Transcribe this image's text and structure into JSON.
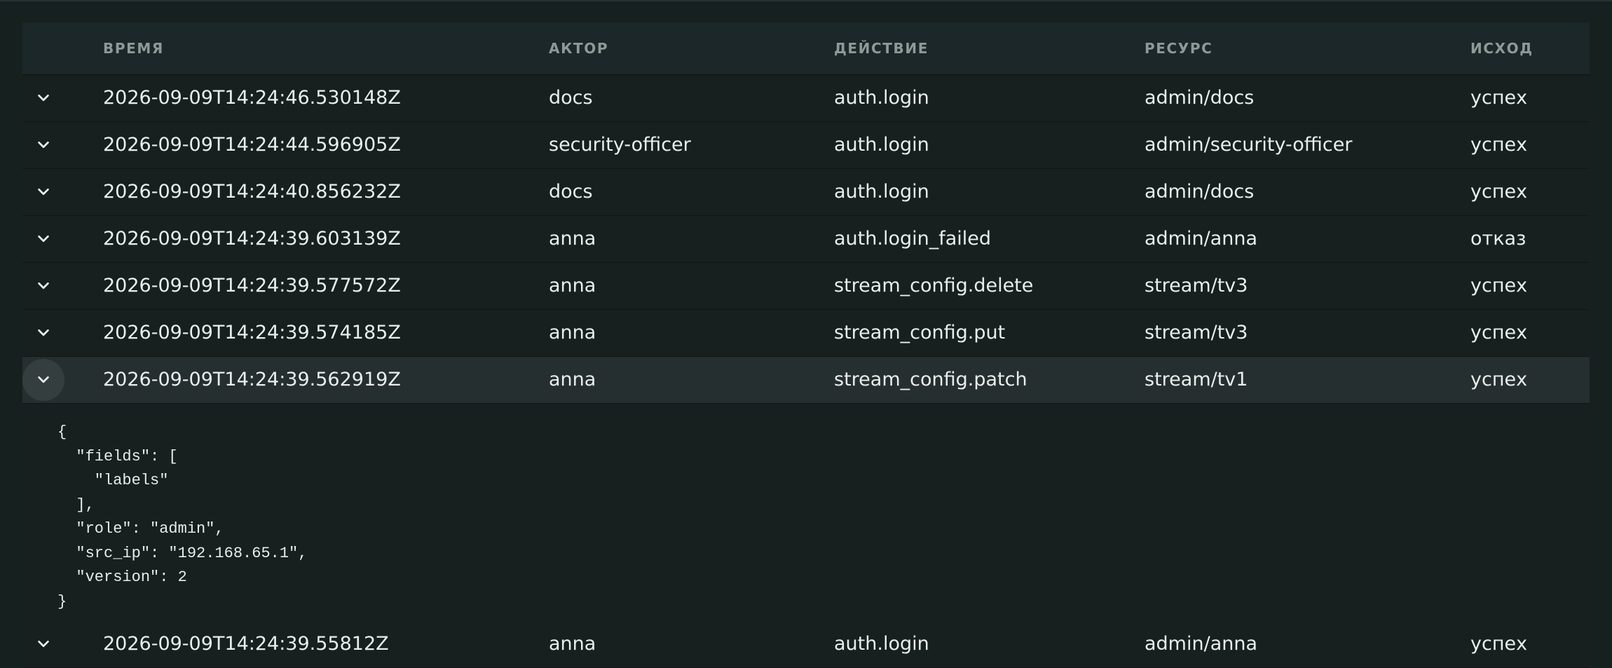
{
  "table": {
    "columns": {
      "time": "ВРЕМЯ",
      "actor": "АКТОР",
      "action": "ДЕЙСТВИЕ",
      "resource": "РЕСУРС",
      "outcome": "ИСХОД"
    },
    "toggle_icon": "chevron-down-icon",
    "rows": [
      {
        "time": "2026-09-09T14:24:46.530148Z",
        "actor": "docs",
        "action": "auth.login",
        "resource": "admin/docs",
        "outcome": "успех"
      },
      {
        "time": "2026-09-09T14:24:44.596905Z",
        "actor": "security-officer",
        "action": "auth.login",
        "resource": "admin/security-officer",
        "outcome": "успех"
      },
      {
        "time": "2026-09-09T14:24:40.856232Z",
        "actor": "docs",
        "action": "auth.login",
        "resource": "admin/docs",
        "outcome": "успех"
      },
      {
        "time": "2026-09-09T14:24:39.603139Z",
        "actor": "anna",
        "action": "auth.login_failed",
        "resource": "admin/anna",
        "outcome": "отказ"
      },
      {
        "time": "2026-09-09T14:24:39.577572Z",
        "actor": "anna",
        "action": "stream_config.delete",
        "resource": "stream/tv3",
        "outcome": "успех"
      },
      {
        "time": "2026-09-09T14:24:39.574185Z",
        "actor": "anna",
        "action": "stream_config.put",
        "resource": "stream/tv3",
        "outcome": "успех"
      },
      {
        "time": "2026-09-09T14:24:39.562919Z",
        "actor": "anna",
        "action": "stream_config.patch",
        "resource": "stream/tv1",
        "outcome": "успех"
      }
    ],
    "expanded_detail": "{\n  \"fields\": [\n    \"labels\"\n  ],\n  \"role\": \"admin\",\n  \"src_ip\": \"192.168.65.1\",\n  \"version\": 2\n}",
    "after_rows": [
      {
        "time": "2026-09-09T14:24:39.55812Z",
        "actor": "anna",
        "action": "auth.login",
        "resource": "admin/anna",
        "outcome": "успех"
      }
    ]
  }
}
